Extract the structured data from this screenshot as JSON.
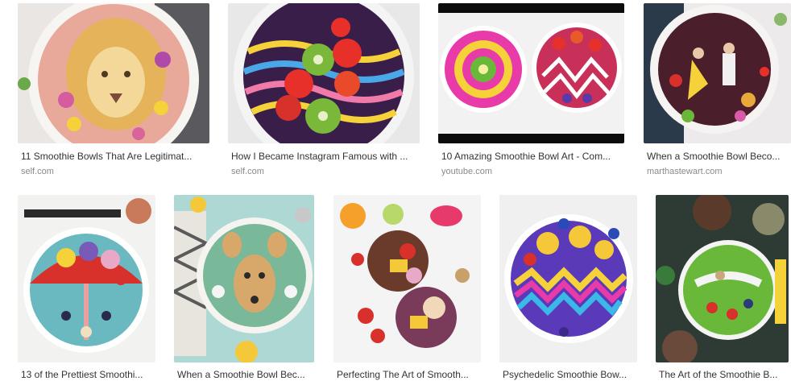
{
  "results": [
    {
      "caption": "11 Smoothie Bowls That Are Legitimat...",
      "source": "self.com",
      "icon": "lion-smoothie-bowl-image"
    },
    {
      "caption": "How I Became Instagram Famous with ...",
      "source": "self.com",
      "icon": "kiwi-rainbow-smoothie-bowl-image"
    },
    {
      "caption": "10 Amazing Smoothie Bowl Art - Com...",
      "source": "youtube.com",
      "icon": "mandala-smoothie-bowls-image"
    },
    {
      "caption": "When a Smoothie Bowl Beco...",
      "source": "marthastewart.com",
      "icon": "dancers-smoothie-bowl-image"
    },
    {
      "caption": "13 of the Prettiest Smoothi...",
      "icon": "flower-smoothie-bowl-image"
    },
    {
      "caption": "When a Smoothie Bowl Bec...",
      "icon": "deer-smoothie-bowl-image"
    },
    {
      "caption": "Perfecting The Art of Smooth...",
      "icon": "fruit-bowls-image"
    },
    {
      "caption": "Psychedelic Smoothie Bow...",
      "icon": "psychedelic-smoothie-bowl-image"
    },
    {
      "caption": "The Art of the Smoothie B...",
      "icon": "green-smoothie-bowls-image"
    }
  ]
}
